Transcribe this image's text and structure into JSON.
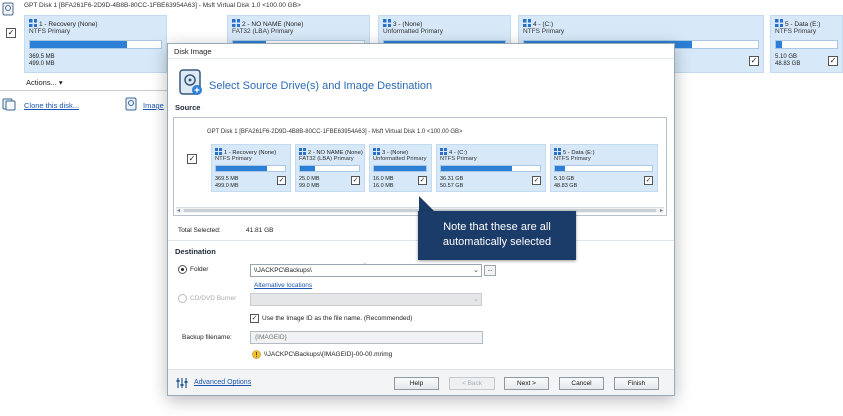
{
  "background": {
    "disk_header": "GPT Disk 1 [BFA261F6-2D9D-4B8B-80CC-1FBE63954A63] - Msft     Virtual Disk     1.0  <100.00 GB>",
    "partitions": [
      {
        "title": "1 - Recovery (None)",
        "type": "NTFS Primary",
        "size1": "369.5 MB",
        "size2": "499.0 MB",
        "used_fraction": 0.74,
        "checked": true
      },
      {
        "title": "2 - NO NAME (None)",
        "type": "FAT32 (LBA) Primary",
        "size1": "",
        "size2": "",
        "used_fraction": 0.25,
        "checked": true
      },
      {
        "title": "3 - (None)",
        "type": "Unformatted Primary",
        "size1": "",
        "size2": "",
        "used_fraction": 1.0,
        "checked": true
      },
      {
        "title": "4 - (C:)",
        "type": "NTFS Primary",
        "size1": "",
        "size2": "",
        "used_fraction": 0.72,
        "checked": true
      },
      {
        "title": "5 - Data (E:)",
        "type": "NTFS Primary",
        "size1": "5.10 GB",
        "size2": "48.83 GB",
        "used_fraction": 0.1,
        "checked": true
      }
    ],
    "actions_label": "Actions... ▾",
    "clone_link": "Clone this disk...",
    "image_link": "Image"
  },
  "dialog": {
    "title": "Disk Image",
    "heading": "Select Source Drive(s) and Image Destination",
    "source": {
      "label": "Source",
      "disk_header": "GPT Disk 1 [BFA261F6-2D9D-4B8B-80CC-1FBE63954A63] - Msft     Virtual Disk     1.0  <100.00 GB>",
      "partitions": [
        {
          "title": "1 - Recovery (None)",
          "type": "NTFS Primary",
          "size1": "369.5 MB",
          "size2": "499.0 MB",
          "used_fraction": 0.74,
          "checked": true
        },
        {
          "title": "2 - NO NAME (None)",
          "type": "FAT32 (LBA) Primary",
          "size1": "25.0 MB",
          "size2": "99.0 MB",
          "used_fraction": 0.25,
          "checked": true
        },
        {
          "title": "3 - (None)",
          "type": "Unformatted Primary",
          "size1": "16.0 MB",
          "size2": "16.0 MB",
          "used_fraction": 1.0,
          "checked": true
        },
        {
          "title": "4 - (C:)",
          "type": "NTFS Primary",
          "size1": "36.31 GB",
          "size2": "50.57 GB",
          "used_fraction": 0.72,
          "checked": true
        },
        {
          "title": "5 - Data (E:)",
          "type": "NTFS Primary",
          "size1": "5.10 GB",
          "size2": "48.83 GB",
          "used_fraction": 0.1,
          "checked": true
        }
      ],
      "total_label": "Total Selected:",
      "total_value": "41.81 GB"
    },
    "destination": {
      "label": "Destination",
      "folder_label": "Folder",
      "folder_value": "\\\\JACKPC\\Backups\\",
      "alt_locations": "Alternative locations",
      "cd_label": "CD/DVD Burner",
      "use_image_id": "Use the Image ID as the file name.  (Recommended)",
      "backup_filename_label": "Backup filename:",
      "backup_filename_value": "{IMAGEID}",
      "path_preview": "\\\\JACKPC\\Backups\\{IMAGEID}-00-00.mrimg"
    },
    "footer": {
      "advanced": "Advanced Options",
      "help": "Help",
      "back": "< Back",
      "next": "Next >",
      "cancel": "Cancel",
      "finish": "Finish"
    }
  },
  "callout": {
    "line1": "Note that these are all",
    "line2": "automatically selected"
  },
  "colors": {
    "accent_blue": "#2c7fd4",
    "partition_bg": "#d7e9f8",
    "heading_blue": "#2c6bb5",
    "callout_bg": "#1b3b68",
    "link_blue": "#1a55b0"
  }
}
